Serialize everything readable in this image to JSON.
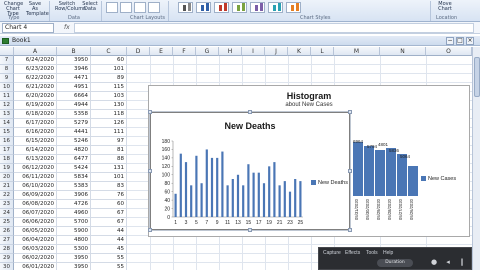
{
  "ribbon": {
    "buttons": [
      {
        "label": "Change\nChart Type"
      },
      {
        "label": "Save As\nTemplate"
      },
      {
        "label": "Switch\nRow/Column"
      },
      {
        "label": "Select\nData"
      },
      {
        "label": "Move\nChart"
      }
    ],
    "groups": {
      "type": "Type",
      "data": "Data",
      "layouts": "Chart Layouts",
      "styles": "Chart Styles",
      "location": "Location"
    }
  },
  "namebox": {
    "value": "Chart 4"
  },
  "formula_bar": {
    "fx": "fx",
    "value": ""
  },
  "workbook": {
    "title": "Book1",
    "min": "−",
    "max": "□",
    "close": "×"
  },
  "columns": [
    "A",
    "B",
    "C",
    "D",
    "E",
    "F",
    "G",
    "H",
    "I",
    "J",
    "K",
    "L",
    "M",
    "N",
    "O"
  ],
  "rows": [
    {
      "n": "7",
      "date": "6/24/2020",
      "b": "3950",
      "c": "60"
    },
    {
      "n": "8",
      "date": "6/23/2020",
      "b": "3946",
      "c": "101"
    },
    {
      "n": "9",
      "date": "6/22/2020",
      "b": "4471",
      "b2": "",
      "c": "89"
    },
    {
      "n": "10",
      "date": "6/21/2020",
      "b": "4951",
      "c": "115"
    },
    {
      "n": "11",
      "date": "6/20/2020",
      "b": "6664",
      "c": "103"
    },
    {
      "n": "12",
      "date": "6/19/2020",
      "b": "4944",
      "c": "130"
    },
    {
      "n": "13",
      "date": "6/18/2020",
      "b": "5358",
      "c": "118"
    },
    {
      "n": "14",
      "date": "6/17/2020",
      "b": "5279",
      "c": "126"
    },
    {
      "n": "15",
      "date": "6/16/2020",
      "b": "4441",
      "c": "111"
    },
    {
      "n": "16",
      "date": "6/15/2020",
      "b": "5246",
      "c": "97"
    },
    {
      "n": "17",
      "date": "6/14/2020",
      "b": "4820",
      "c": "81"
    },
    {
      "n": "18",
      "date": "6/13/2020",
      "b": "6477",
      "c": "88"
    },
    {
      "n": "19",
      "date": "06/12/2020",
      "b": "5424",
      "c": "131"
    },
    {
      "n": "20",
      "date": "06/11/2020",
      "b": "5834",
      "c": "101"
    },
    {
      "n": "21",
      "date": "06/10/2020",
      "b": "5383",
      "c": "83"
    },
    {
      "n": "22",
      "date": "06/09/2020",
      "b": "3906",
      "c": "76"
    },
    {
      "n": "23",
      "date": "06/08/2020",
      "b": "4726",
      "c": "60"
    },
    {
      "n": "24",
      "date": "06/07/2020",
      "b": "4960",
      "c": "67"
    },
    {
      "n": "25",
      "date": "06/06/2020",
      "b": "5700",
      "c": "67"
    },
    {
      "n": "26",
      "date": "06/05/2020",
      "b": "5900",
      "c": "44"
    },
    {
      "n": "27",
      "date": "06/04/2020",
      "b": "4800",
      "c": "44"
    },
    {
      "n": "28",
      "date": "06/03/2020",
      "b": "5300",
      "c": "45"
    },
    {
      "n": "29",
      "date": "06/02/2020",
      "b": "3950",
      "c": "55"
    },
    {
      "n": "30",
      "date": "06/01/2020",
      "b": "3950",
      "c": "55"
    }
  ],
  "histogram": {
    "title": "Histogram",
    "subtitle": "about New Cases",
    "legend": "New Cases",
    "visible_labels": [
      "6964",
      "5794",
      "4801",
      "5836",
      "5064"
    ],
    "x_labels": [
      "05/31/2020",
      "05/30/2020",
      "05/29/2020",
      "05/28/2020",
      "05/27/2020",
      "05/26/2020"
    ]
  },
  "chart_data": {
    "type": "bar",
    "title": "New Deaths",
    "xlabel": "",
    "ylabel": "",
    "ylim": [
      0,
      180
    ],
    "yticks": [
      0,
      20,
      40,
      60,
      80,
      100,
      120,
      140,
      160,
      180
    ],
    "xticks": [
      "1",
      "3",
      "5",
      "7",
      "9",
      "11",
      "13",
      "15",
      "17",
      "19",
      "21",
      "23",
      "25"
    ],
    "categories": [
      "1",
      "2",
      "3",
      "4",
      "5",
      "6",
      "7",
      "8",
      "9",
      "10",
      "11",
      "12",
      "13",
      "14",
      "15",
      "16",
      "17",
      "18",
      "19",
      "20",
      "21",
      "22",
      "23",
      "24",
      "25"
    ],
    "series": [
      {
        "name": "New Deaths",
        "values": [
          55,
          150,
          130,
          75,
          145,
          80,
          160,
          140,
          140,
          155,
          75,
          90,
          100,
          75,
          125,
          105,
          105,
          80,
          120,
          130,
          75,
          85,
          60,
          90,
          85
        ]
      }
    ],
    "legend": "right",
    "grid": false
  },
  "overlay": {
    "menu": [
      "Capture",
      "Effects",
      "Tools",
      "Help"
    ],
    "pill": "Duration"
  },
  "colors": {
    "bar": "#4a76b5",
    "overlay": "#2b2d31"
  }
}
